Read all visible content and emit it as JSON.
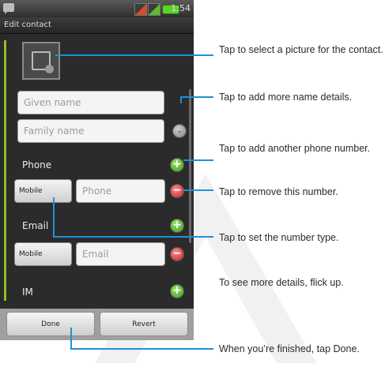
{
  "statusbar": {
    "time": "1:54 PM"
  },
  "screen": {
    "title": "Edit contact"
  },
  "form": {
    "given_name_placeholder": "Given name",
    "family_name_placeholder": "Family name",
    "phone_section": "Phone",
    "phone_type": "Mobile",
    "phone_placeholder": "Phone",
    "email_section": "Email",
    "email_type": "Mobile",
    "email_placeholder": "Email",
    "im_section": "IM"
  },
  "buttons": {
    "done": "Done",
    "revert": "Revert"
  },
  "callouts": {
    "picture": "Tap to select a picture for the contact.",
    "name_details": "Tap to add more name details.",
    "add_phone": "Tap to add another phone number.",
    "remove_number": "Tap to remove this number.",
    "number_type": "Tap to set the number type.",
    "flick_up": "To see more details, flick up.",
    "finished_prefix": "When you’re finished, tap ",
    "finished_key": "Done",
    "finished_suffix": "."
  },
  "colors": {
    "callout_line": "#1a94d6",
    "accent_green": "#8cbd2a"
  }
}
